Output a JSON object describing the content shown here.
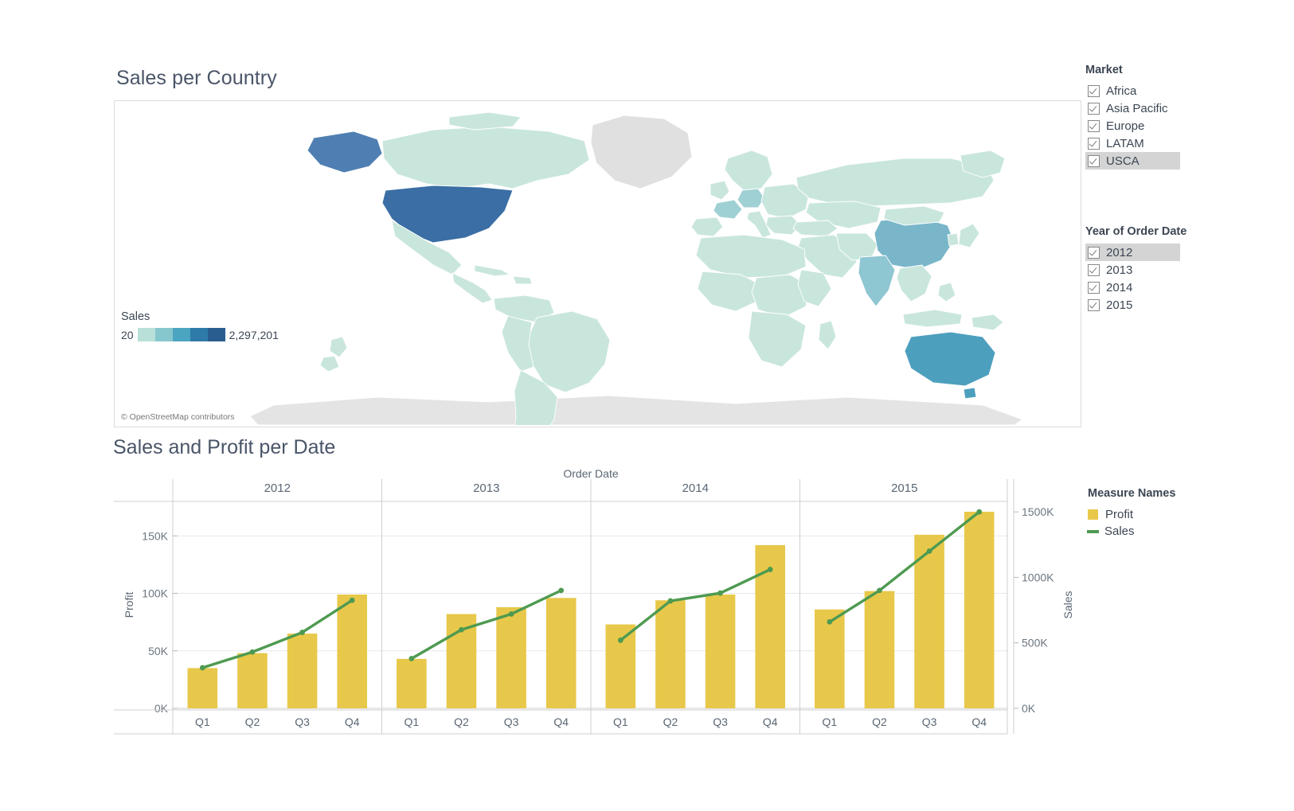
{
  "map": {
    "title": "Sales per Country",
    "attribution": "© OpenStreetMap contributors",
    "legend": {
      "title": "Sales",
      "min_label": "20",
      "max_label": "2,297,201",
      "colors": [
        "#b8e0d8",
        "#86c7cd",
        "#4ba4c0",
        "#2f7aa8",
        "#2a5d8f"
      ]
    },
    "base_country_color": "#c9e6dd",
    "no_data_color": "#e0e0e0",
    "border_color": "#ffffff",
    "highlight_countries": [
      {
        "name": "United States",
        "color": "#3a6ea5"
      },
      {
        "name": "Alaska",
        "color": "#4f7fb2"
      },
      {
        "name": "China",
        "color": "#79b6c9"
      },
      {
        "name": "Australia",
        "color": "#4d9fbe"
      },
      {
        "name": "India",
        "color": "#8ec6d1"
      },
      {
        "name": "France",
        "color": "#9fd0d4"
      },
      {
        "name": "Germany",
        "color": "#9fd0d4"
      }
    ]
  },
  "filters": {
    "market": {
      "title": "Market",
      "items": [
        {
          "label": "Africa",
          "checked": true,
          "highlighted": false
        },
        {
          "label": "Asia Pacific",
          "checked": true,
          "highlighted": false
        },
        {
          "label": "Europe",
          "checked": true,
          "highlighted": false
        },
        {
          "label": "LATAM",
          "checked": true,
          "highlighted": false
        },
        {
          "label": "USCA",
          "checked": true,
          "highlighted": true
        }
      ]
    },
    "year": {
      "title": "Year of Order Date",
      "items": [
        {
          "label": "2012",
          "checked": true,
          "highlighted": true
        },
        {
          "label": "2013",
          "checked": true,
          "highlighted": false
        },
        {
          "label": "2014",
          "checked": true,
          "highlighted": false
        },
        {
          "label": "2015",
          "checked": true,
          "highlighted": false
        }
      ]
    }
  },
  "chart": {
    "title": "Sales and Profit per Date",
    "legend": {
      "title": "Measure Names",
      "items": [
        {
          "label": "Profit",
          "color": "#e8c84a",
          "shape": "square"
        },
        {
          "label": "Sales",
          "color": "#4e9a51",
          "shape": "line"
        }
      ]
    }
  },
  "chart_data": {
    "type": "bar",
    "title": "Sales and Profit per Date",
    "xlabel": "Order Date",
    "ylabel": "Profit",
    "y2label": "Sales",
    "grid": true,
    "legend_position": "right",
    "groups": [
      "2012",
      "2013",
      "2014",
      "2015"
    ],
    "categories": [
      "2012 Q1",
      "2012 Q2",
      "2012 Q3",
      "2012 Q4",
      "2013 Q1",
      "2013 Q2",
      "2013 Q3",
      "2013 Q4",
      "2014 Q1",
      "2014 Q2",
      "2014 Q3",
      "2014 Q4",
      "2015 Q1",
      "2015 Q2",
      "2015 Q3",
      "2015 Q4"
    ],
    "quarter_labels": [
      "Q1",
      "Q2",
      "Q3",
      "Q4"
    ],
    "series": [
      {
        "name": "Profit",
        "type": "bar",
        "axis": "left",
        "color": "#e8c84a",
        "values": [
          35000,
          48000,
          65000,
          99000,
          43000,
          82000,
          88000,
          96000,
          73000,
          94000,
          99000,
          142000,
          86000,
          102000,
          151000,
          171000
        ]
      },
      {
        "name": "Sales",
        "type": "line",
        "axis": "right",
        "color": "#4e9a51",
        "values": [
          310000,
          430000,
          580000,
          825000,
          380000,
          600000,
          720000,
          900000,
          520000,
          820000,
          880000,
          1060000,
          660000,
          900000,
          1200000,
          1500000
        ]
      }
    ],
    "y_axis_left": {
      "label": "Profit",
      "ticks": [
        "0K",
        "50K",
        "100K",
        "150K"
      ],
      "tick_values": [
        0,
        50000,
        100000,
        150000
      ],
      "ylim": [
        0,
        180000
      ]
    },
    "y_axis_right": {
      "label": "Sales",
      "ticks": [
        "0K",
        "500K",
        "1000K",
        "1500K"
      ],
      "tick_values": [
        0,
        500000,
        1000000,
        1500000
      ],
      "ylim": [
        0,
        1580000
      ]
    }
  }
}
